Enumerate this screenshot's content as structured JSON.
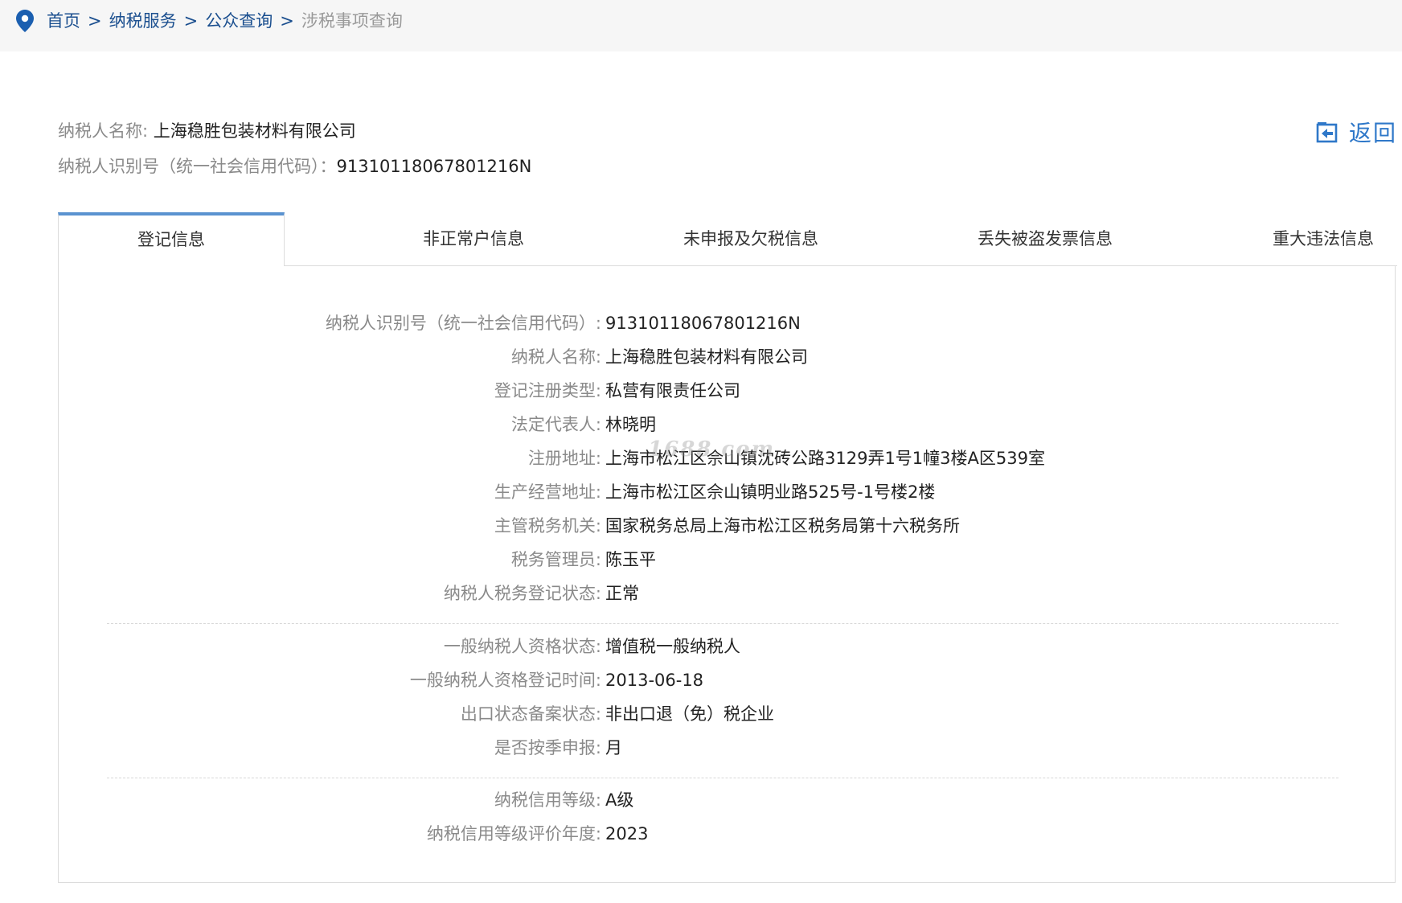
{
  "breadcrumb": {
    "home": "首页",
    "sep1": ">",
    "service": "纳税服务",
    "sep2": ">",
    "query": "公众查询",
    "sep3": ">",
    "current": "涉税事项查询"
  },
  "header": {
    "name_label": "纳税人名称:",
    "name_value": "上海稳胜包装材料有限公司",
    "id_label": "纳税人识别号（统一社会信用代码）：",
    "id_value": "91310118067801216N",
    "back_label": "返回"
  },
  "tabs": [
    {
      "label": "登记信息",
      "active": true
    },
    {
      "label": "非正常户信息",
      "active": false
    },
    {
      "label": "未申报及欠税信息",
      "active": false
    },
    {
      "label": "丢失被盗发票信息",
      "active": false
    },
    {
      "label": "重大违法信息",
      "active": false
    }
  ],
  "watermark": "1688.com",
  "details": {
    "group1": [
      {
        "label": "纳税人识别号（统一社会信用代码）:",
        "value": "91310118067801216N"
      },
      {
        "label": "纳税人名称:",
        "value": "上海稳胜包装材料有限公司"
      },
      {
        "label": "登记注册类型:",
        "value": "私营有限责任公司"
      },
      {
        "label": "法定代表人:",
        "value": "林晓明"
      },
      {
        "label": "注册地址:",
        "value": "上海市松江区佘山镇沈砖公路3129弄1号1幢3楼A区539室"
      },
      {
        "label": "生产经营地址:",
        "value": "上海市松江区佘山镇明业路525号-1号楼2楼"
      },
      {
        "label": "主管税务机关:",
        "value": "国家税务总局上海市松江区税务局第十六税务所"
      },
      {
        "label": "税务管理员:",
        "value": "陈玉平"
      },
      {
        "label": "纳税人税务登记状态:",
        "value": "正常"
      }
    ],
    "group2": [
      {
        "label": "一般纳税人资格状态:",
        "value": "增值税一般纳税人"
      },
      {
        "label": "一般纳税人资格登记时间:",
        "value": "2013-06-18"
      },
      {
        "label": "出口状态备案状态:",
        "value": "非出口退（免）税企业"
      },
      {
        "label": "是否按季申报:",
        "value": "月"
      }
    ],
    "group3": [
      {
        "label": "纳税信用等级:",
        "value": "A级"
      },
      {
        "label": "纳税信用等级评价年度:",
        "value": "2023"
      }
    ]
  },
  "colors": {
    "link": "#1b4f8f",
    "accent": "#2f78c9",
    "tab_active_border": "#5a93d0"
  }
}
